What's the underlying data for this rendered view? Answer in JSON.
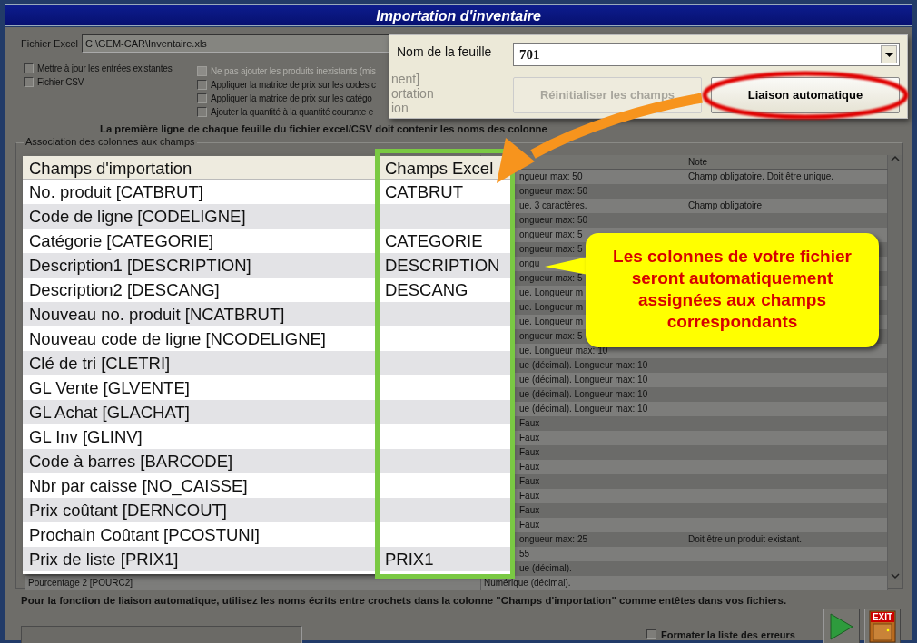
{
  "window": {
    "title": "Importation d'inventaire"
  },
  "file": {
    "label": "Fichier Excel",
    "value": "C:\\GEM-CAR\\Inventaire.xls"
  },
  "options_left": [
    {
      "label": "Mettre à jour les entrées existantes",
      "checked": false,
      "disabled": false
    },
    {
      "label": "Fichier CSV",
      "checked": false,
      "disabled": false
    }
  ],
  "options_right": [
    {
      "label": "Ne pas ajouter les produits inexistants (mis",
      "checked": false,
      "disabled": true
    },
    {
      "label": "Appliquer la matrice de prix sur les codes c",
      "checked": false,
      "disabled": false
    },
    {
      "label": "Appliquer la matrice de prix sur les catégo",
      "checked": false,
      "disabled": false
    },
    {
      "label": "Ajouter la quantité à la quantité courante e",
      "checked": false,
      "disabled": false
    }
  ],
  "notice": "La première ligne de chaque feuille du fichier excel/CSV doit contenir les noms des colonne",
  "group": {
    "title": "Association des colonnes aux champs",
    "grid": {
      "note_header": "Note",
      "rows": [
        {
          "type": "ngueur max: 50",
          "note": "Champ obligatoire. Doit être unique."
        },
        {
          "type": "ongueur max: 50"
        },
        {
          "type": "ue. 3 caractères.",
          "note": "Champ obligatoire"
        },
        {
          "type": "ongueur max: 50"
        },
        {
          "type": "ongueur max: 5"
        },
        {
          "type": "ongueur max: 5"
        },
        {
          "type": "ongu"
        },
        {
          "type": "ongueur max: 5"
        },
        {
          "type": "ue. Longueur m"
        },
        {
          "type": "ue. Longueur m"
        },
        {
          "type": "ue. Longueur m"
        },
        {
          "type": "ongueur max: 5"
        },
        {
          "type": "ue. Longueur max: 10"
        },
        {
          "type": "ue (décimal). Longueur max: 10"
        },
        {
          "type": "ue (décimal). Longueur max: 10"
        },
        {
          "type": "ue (décimal). Longueur max: 10"
        },
        {
          "type": "ue (décimal). Longueur max: 10"
        },
        {
          "type": "Faux"
        },
        {
          "type": "Faux"
        },
        {
          "type": "Faux"
        },
        {
          "type": "Faux"
        },
        {
          "type": "Faux"
        },
        {
          "type": "Faux"
        },
        {
          "type": "Faux"
        },
        {
          "type": "Faux"
        },
        {
          "type": "ongueur max: 25",
          "note": "Doit être un produit existant."
        },
        {
          "type": "55"
        },
        {
          "type": "ue (décimal)."
        },
        {
          "field": "Pourcentage 2 [POURC2]",
          "type": "Numérique (décimal)."
        }
      ]
    }
  },
  "sheet_popup": {
    "label": "Nom de la feuille",
    "faded_texts": [
      "nent]",
      "ortation",
      "ion"
    ],
    "sheet": "701",
    "buttons": [
      {
        "label": "Réinitialiser les champs",
        "disabled": true,
        "highlighted": false
      },
      {
        "label": "Liaison automatique",
        "disabled": false,
        "highlighted": true
      }
    ]
  },
  "import_table": {
    "columns": [
      "Champs d'importation",
      "Champs Excel"
    ],
    "rows": [
      {
        "field": "No. produit [CATBRUT]",
        "excel": "CATBRUT"
      },
      {
        "field": "Code de ligne [CODELIGNE]"
      },
      {
        "field": "Catégorie [CATEGORIE]",
        "excel": "CATEGORIE"
      },
      {
        "field": "Description1 [DESCRIPTION]",
        "excel": "DESCRIPTION"
      },
      {
        "field": "Description2 [DESCANG]",
        "excel": "DESCANG"
      },
      {
        "field": "Nouveau no. produit [NCATBRUT]"
      },
      {
        "field": "Nouveau code de ligne [NCODELIGNE]"
      },
      {
        "field": "Clé de tri [CLETRI]"
      },
      {
        "field": "GL Vente [GLVENTE]"
      },
      {
        "field": "GL Achat [GLACHAT]"
      },
      {
        "field": "GL Inv [GLINV]"
      },
      {
        "field": "Code à barres [BARCODE]"
      },
      {
        "field": "Nbr par caisse [NO_CAISSE]"
      },
      {
        "field": "Prix coûtant [DERNCOUT]"
      },
      {
        "field": "Prochain Coûtant [PCOSTUNI]"
      },
      {
        "field": "Prix de liste [PRIX1]",
        "excel": "PRIX1"
      }
    ]
  },
  "callout": "Les colonnes de votre fichier seront automatiquement assignées aux champs correspondants",
  "footer": {
    "hint": "Pour la fonction de liaison automatique, utilisez les noms écrits entre crochets dans la colonne \"Champs d'importation\" comme entêtes dans vos fichiers.",
    "error_format": {
      "label": "Formater la liste des erreurs",
      "checked": false
    },
    "exit_label": "EXIT"
  }
}
